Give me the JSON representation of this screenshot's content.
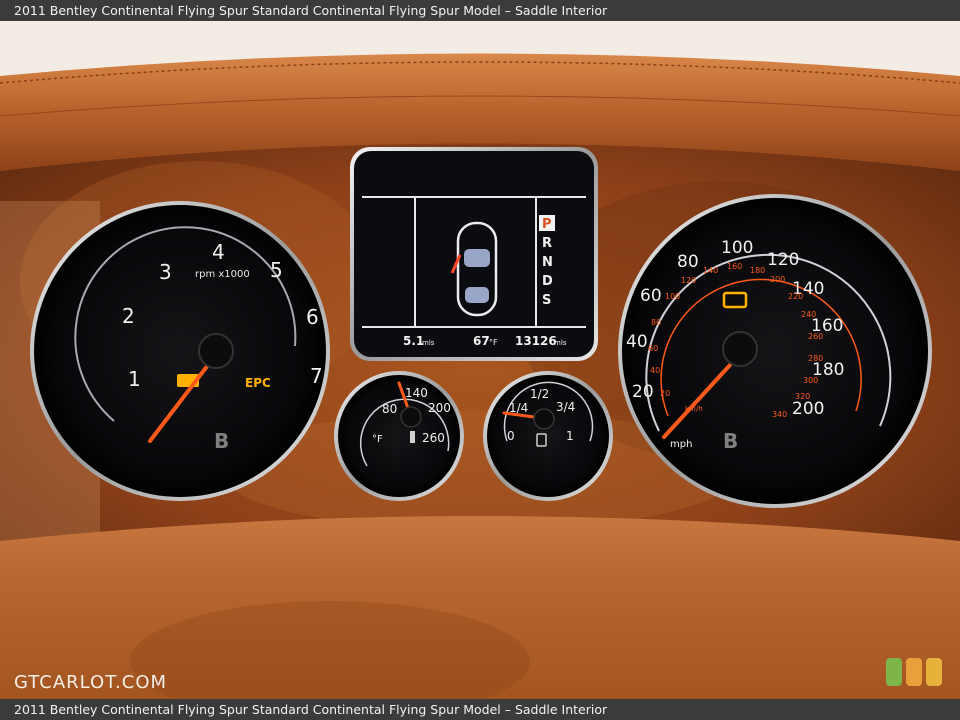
{
  "caption": {
    "top": "2011 Bentley Continental Flying Spur Standard Continental Flying Spur Model – Saddle Interior",
    "bottom": "2011 Bentley Continental Flying Spur Standard Continental Flying Spur Model – Saddle Interior"
  },
  "watermark": {
    "text": "GTCARLOT.COM"
  },
  "tachometer": {
    "ticks": [
      "1",
      "2",
      "3",
      "4",
      "5",
      "6",
      "7"
    ],
    "unit": "rpm x1000",
    "warning": "EPC"
  },
  "display": {
    "gear_letters": [
      "P",
      "R",
      "N",
      "D",
      "S"
    ],
    "active_gear": "P",
    "range": "5.1",
    "range_unit": "mls",
    "temp": "67",
    "temp_unit": "°F",
    "odometer": "13126",
    "odometer_unit": "mls"
  },
  "temp_gauge": {
    "ticks": [
      "80",
      "140",
      "200",
      "260"
    ],
    "unit": "°F"
  },
  "fuel_gauge": {
    "ticks": [
      "0",
      "1/4",
      "1/2",
      "3/4",
      "1"
    ]
  },
  "speedometer": {
    "mph_ticks": [
      "20",
      "40",
      "60",
      "80",
      "100",
      "120",
      "140",
      "160",
      "180",
      "200"
    ],
    "kmh_ticks": [
      "20",
      "40",
      "60",
      "80",
      "100",
      "120",
      "140",
      "160",
      "180",
      "200",
      "220",
      "240",
      "260",
      "280",
      "300",
      "320",
      "340"
    ],
    "unit": "mph",
    "kmh_unit": "km/h"
  },
  "brand_logo": "B",
  "colors": {
    "leather": "#b9652d",
    "wood": "#9a4a1f",
    "needle": "#ff5a1a",
    "warning": "#ffb000"
  }
}
